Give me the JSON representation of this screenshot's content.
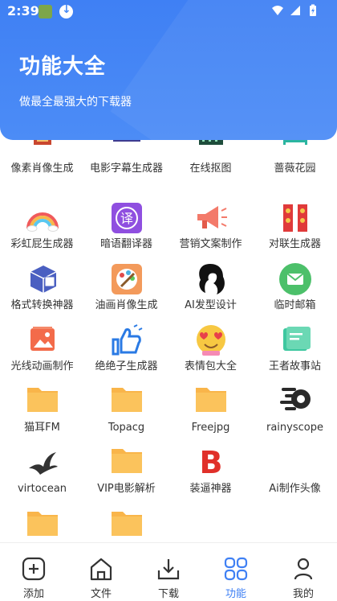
{
  "status_bar": {
    "time": "2:39"
  },
  "header": {
    "title": "功能大全",
    "subtitle": "做最全最强大的下载器"
  },
  "features": [
    {
      "label": "像素肖像生成",
      "icon": "pixel-art-icon"
    },
    {
      "label": "电影字幕生成器",
      "icon": "film-subtitle-icon"
    },
    {
      "label": "在线抠图",
      "icon": "cutout-icon"
    },
    {
      "label": "蔷薇花园",
      "icon": "garden-fence-icon"
    },
    {
      "label": "彩虹屁生成器",
      "icon": "rainbow-icon"
    },
    {
      "label": "暗语翻译器",
      "icon": "translate-icon"
    },
    {
      "label": "营销文案制作",
      "icon": "megaphone-icon"
    },
    {
      "label": "对联生成器",
      "icon": "couplet-icon"
    },
    {
      "label": "格式转换神器",
      "icon": "cube-convert-icon"
    },
    {
      "label": "油画肖像生成",
      "icon": "palette-icon"
    },
    {
      "label": "AI发型设计",
      "icon": "hairstyle-icon"
    },
    {
      "label": "临时邮箱",
      "icon": "mail-icon"
    },
    {
      "label": "光线动画制作",
      "icon": "light-image-icon"
    },
    {
      "label": "绝绝子生成器",
      "icon": "thumbs-up-icon"
    },
    {
      "label": "表情包大全",
      "icon": "heart-eyes-emoji-icon"
    },
    {
      "label": "王者故事站",
      "icon": "book-icon"
    },
    {
      "label": "猫耳FM",
      "icon": "folder-icon"
    },
    {
      "label": "Topacg",
      "icon": "folder-icon"
    },
    {
      "label": "Freejpg",
      "icon": "folder-icon"
    },
    {
      "label": "rainyscope",
      "icon": "rainyscope-logo-icon"
    },
    {
      "label": "virtocean",
      "icon": "bird-logo-icon"
    },
    {
      "label": "VIP电影解析",
      "icon": "folder-icon"
    },
    {
      "label": "装逼神器",
      "icon": "letter-b-icon"
    },
    {
      "label": "Ai制作头像",
      "icon": "blank-icon"
    },
    {
      "label": "",
      "icon": "folder-icon"
    },
    {
      "label": "",
      "icon": "folder-icon"
    }
  ],
  "bottom_nav": [
    {
      "label": "添加",
      "icon": "add-icon"
    },
    {
      "label": "文件",
      "icon": "home-icon"
    },
    {
      "label": "下载",
      "icon": "download-icon"
    },
    {
      "label": "功能",
      "icon": "grid-icon",
      "active": true
    },
    {
      "label": "我的",
      "icon": "person-icon"
    }
  ],
  "colors": {
    "accent": "#3f80f4",
    "folder": "#f9b54a"
  }
}
